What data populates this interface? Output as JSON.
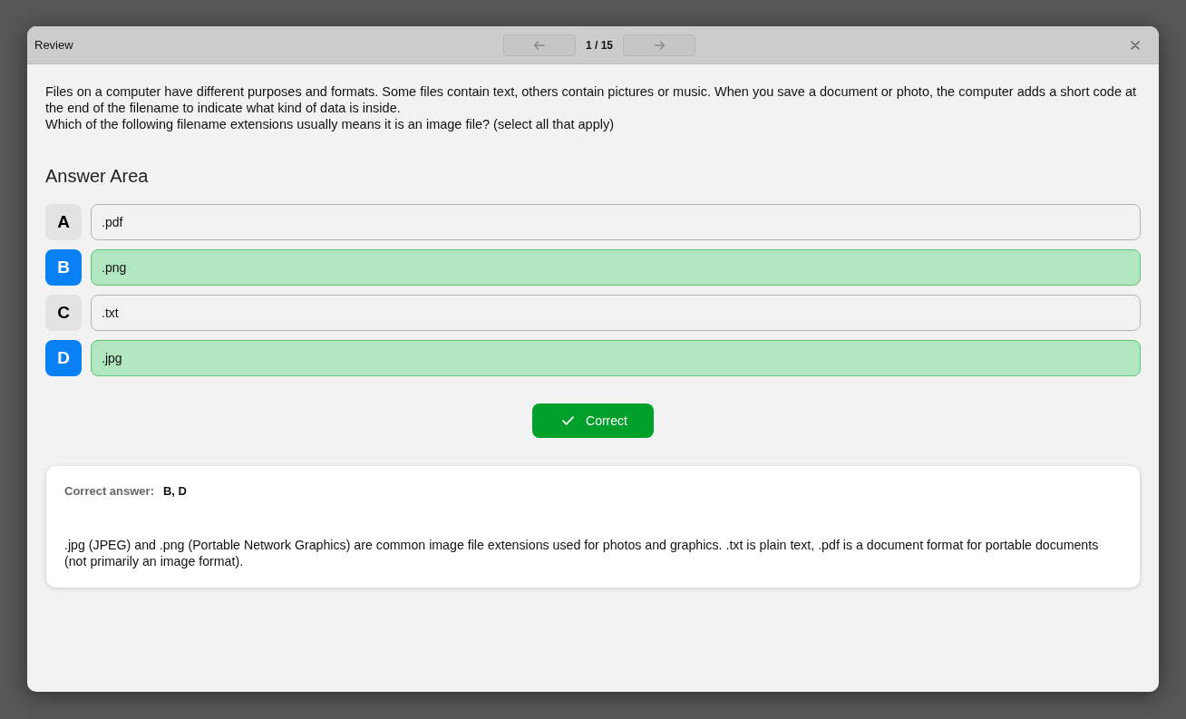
{
  "dialog": {
    "title": "Review",
    "counter": "1 / 15"
  },
  "question": {
    "paragraphs": [
      "Files on a computer have different purposes and formats. Some files contain text, others contain pictures or music. When you save a document or photo, the computer adds a short code at the end of the filename to indicate what kind of data is inside.",
      "Which of the following filename extensions usually means it is an image file? (select all that apply)"
    ]
  },
  "answer_area": {
    "heading": "Answer Area",
    "options": [
      {
        "letter": "A",
        "text": ".pdf",
        "selected": false,
        "correct": false
      },
      {
        "letter": "B",
        "text": ".png",
        "selected": true,
        "correct": true
      },
      {
        "letter": "C",
        "text": ".txt",
        "selected": false,
        "correct": false
      },
      {
        "letter": "D",
        "text": ".jpg",
        "selected": true,
        "correct": true
      }
    ]
  },
  "result": {
    "label": "Correct",
    "correct": true
  },
  "explanation": {
    "label": "Correct answer:",
    "answer": "B, D",
    "text": ".jpg (JPEG) and .png (Portable Network Graphics) are common image file extensions used for photos and graphics. .txt is plain text, .pdf is a document format for portable documents (not primarily an image format)."
  }
}
